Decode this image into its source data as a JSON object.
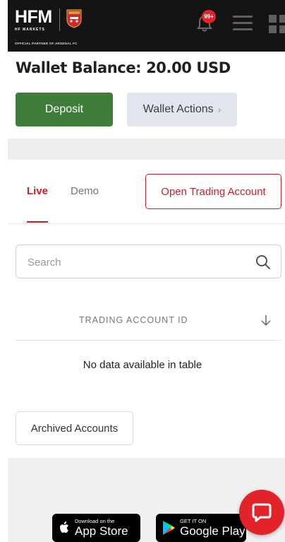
{
  "header": {
    "logo_text": "HFM",
    "logo_sub": "HF MARKETS",
    "partner_text": "OFFICIAL PARTNER OF ARSENAL FC",
    "crest_label": "Arsenal",
    "notification_badge": "99+",
    "icons": [
      "bell-icon",
      "hamburger-menu-icon",
      "apps-grid-icon"
    ]
  },
  "wallet": {
    "balance_text": "Wallet Balance: 20.00 USD",
    "deposit_label": "Deposit",
    "actions_label": "Wallet Actions",
    "actions_chevron": "›"
  },
  "tabs": [
    {
      "label": "Live",
      "active": true
    },
    {
      "label": "Demo",
      "active": false
    }
  ],
  "open_account_label": "Open Trading Account",
  "search": {
    "placeholder": "Search",
    "value": ""
  },
  "table": {
    "columns": [
      "TRADING ACCOUNT ID"
    ],
    "empty_text": "No data available in table"
  },
  "archived_label": "Archived Accounts",
  "footer": {
    "app_store": {
      "small": "Download on the",
      "big": "App Store"
    },
    "google_play": {
      "small": "GET IT ON",
      "big": "Google Play"
    }
  },
  "colors": {
    "brand_red": "#e2232a",
    "deposit_green": "#3e7d3a",
    "header_bg": "#141414"
  }
}
